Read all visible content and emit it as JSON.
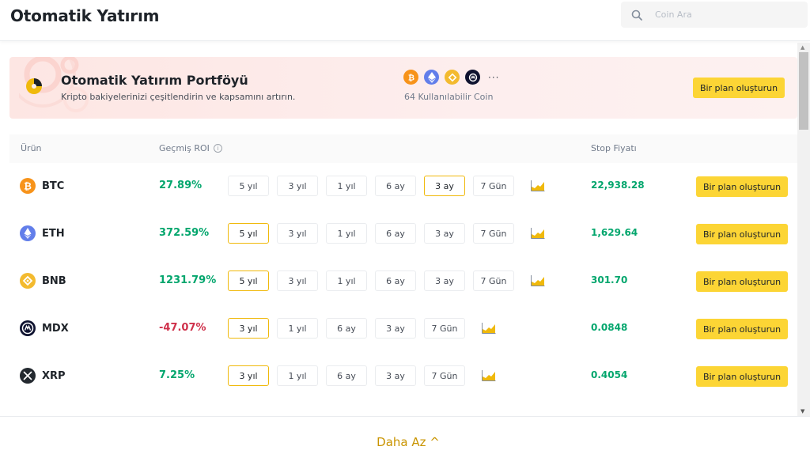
{
  "header": {
    "title": "Otomatik Yatırım",
    "search_placeholder": "Coin Ara"
  },
  "banner": {
    "title": "Otomatik Yatırım Portföyü",
    "subtitle": "Kripto bakiyelerinizi çeşitlendirin ve kapsamını artırın.",
    "coins_label": "64 Kullanılabilir Coin",
    "more": "···",
    "button": "Bir plan oluşturun"
  },
  "table": {
    "headers": {
      "product": "Ürün",
      "roi": "Geçmiş ROI",
      "stop_price": "Stop Fiyatı"
    },
    "rows": [
      {
        "coin": "BTC",
        "roi": "27.89%",
        "periods": [
          "5 yıl",
          "3 yıl",
          "1 yıl",
          "6 ay",
          "3 ay",
          "7 Gün"
        ],
        "active_period": "3 ay",
        "stop_price": "22,938.28",
        "button": "Bir plan oluşturun"
      },
      {
        "coin": "ETH",
        "roi": "372.59%",
        "periods": [
          "5 yıl",
          "3 yıl",
          "1 yıl",
          "6 ay",
          "3 ay",
          "7 Gün"
        ],
        "active_period": "5 yıl",
        "stop_price": "1,629.64",
        "button": "Bir plan oluşturun"
      },
      {
        "coin": "BNB",
        "roi": "1231.79%",
        "periods": [
          "5 yıl",
          "3 yıl",
          "1 yıl",
          "6 ay",
          "3 ay",
          "7 Gün"
        ],
        "active_period": "5 yıl",
        "stop_price": "301.70",
        "button": "Bir plan oluşturun"
      },
      {
        "coin": "MDX",
        "roi": "-47.07%",
        "periods": [
          "3 yıl",
          "1 yıl",
          "6 ay",
          "3 ay",
          "7 Gün"
        ],
        "active_period": "3 yıl",
        "stop_price": "0.0848",
        "button": "Bir plan oluşturun"
      },
      {
        "coin": "XRP",
        "roi": "7.25%",
        "periods": [
          "3 yıl",
          "1 yıl",
          "6 ay",
          "3 ay",
          "7 Gün"
        ],
        "active_period": "3 yıl",
        "stop_price": "0.4054",
        "button": "Bir plan oluşturun"
      }
    ]
  },
  "footer": {
    "less_link": "Daha Az ^"
  },
  "colors": {
    "accent": "#fcd535",
    "positive": "#03a66d",
    "negative": "#cf304a",
    "link": "#c99400",
    "active_border": "#f0b90b"
  },
  "icons": {
    "search": "search-icon",
    "banner": "pie-chart-icon",
    "roi_info": "info-icon",
    "row_chart": "area-chart-icon",
    "coins": {
      "BTC": "bitcoin-icon",
      "ETH": "ethereum-icon",
      "BNB": "bnb-icon",
      "MDX": "mdx-icon",
      "XRP": "xrp-icon"
    }
  }
}
